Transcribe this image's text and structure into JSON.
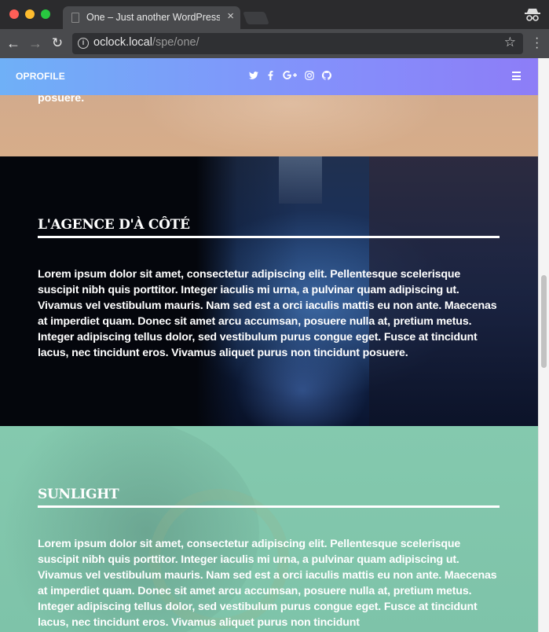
{
  "browser": {
    "tab_title": "One – Just another WordPress",
    "tab_close": "×",
    "url_host": "oclock.local",
    "url_path": "/spe/one/",
    "colors": {
      "titlebar": "#2b2b2d",
      "toolbar": "#494a4d",
      "close": "#fe5f57",
      "minimize": "#febc2e",
      "maximize": "#28c840"
    }
  },
  "site": {
    "brand": "OPROFILE",
    "socials": [
      "twitter-icon",
      "facebook-icon",
      "google-plus-icon",
      "instagram-icon",
      "github-icon"
    ],
    "nav_gradient": [
      "#6fb0f7",
      "#8d7df7"
    ]
  },
  "sections": {
    "peach": {
      "tail_text": "posuere.",
      "color": "#d3ab8b"
    },
    "agence": {
      "title": "L'AGENCE D'À CÔTÉ",
      "body": "Lorem ipsum dolor sit amet, consectetur adipiscing elit. Pellentesque scelerisque suscipit nibh quis porttitor. Integer iaculis mi urna, a pulvinar quam adipiscing ut. Vivamus vel vestibulum mauris. Nam sed est a orci iaculis mattis eu non ante. Maecenas at imperdiet quam. Donec sit amet arcu accumsan, posuere nulla at, pretium metus. Integer adipiscing tellus dolor, sed vestibulum purus congue eget. Fusce at tincidunt lacus, nec tincidunt eros. Vivamus aliquet purus non tincidunt posuere."
    },
    "sunlight": {
      "title": "SUNLIGHT",
      "body": "Lorem ipsum dolor sit amet, consectetur adipiscing elit. Pellentesque scelerisque suscipit nibh quis porttitor. Integer iaculis mi urna, a pulvinar quam adipiscing ut. Vivamus vel vestibulum mauris. Nam sed est a orci iaculis mattis eu non ante. Maecenas at imperdiet quam. Donec sit amet arcu accumsan, posuere nulla at, pretium metus. Integer adipiscing tellus dolor, sed vestibulum purus congue eget. Fusce at tincidunt lacus, nec tincidunt eros. Vivamus aliquet purus non tincidunt",
      "color": "#80c5ab"
    }
  }
}
